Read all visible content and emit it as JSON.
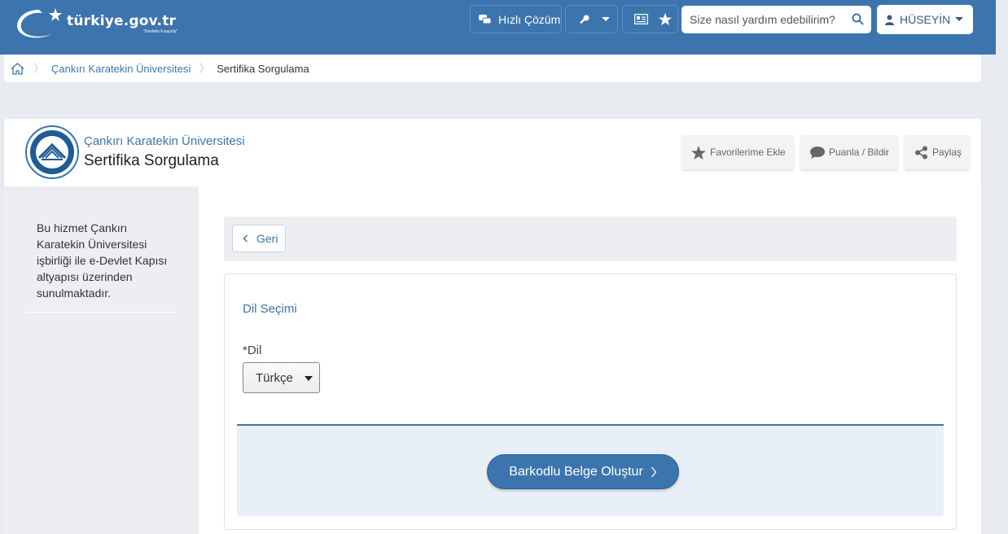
{
  "header": {
    "logo_text": "türkiye.gov.tr",
    "logo_tagline": "\"Devletin Kısayolu\"",
    "quick_solution_label": "Hızlı Çözüm",
    "search_placeholder": "Size nasıl yardım edebilirim?",
    "user_name": "HÜSEYİN"
  },
  "breadcrumb": {
    "items": [
      "Çankırı Karatekin Üniversitesi",
      "Sertifika Sorgulama"
    ]
  },
  "service": {
    "institution": "Çankırı Karatekin Üniversitesi",
    "title": "Sertifika Sorgulama",
    "actions": {
      "favorite": "Favorilerime Ekle",
      "rate": "Puanla / Bildir",
      "share": "Paylaş"
    }
  },
  "sidebar": {
    "info": "Bu hizmet Çankırı Karatekin Üniversitesi işbirliği ile e-Devlet Kapısı altyapısı üzerinden sunulmaktadır."
  },
  "main": {
    "back_label": "Geri",
    "legend": "Dil Seçimi",
    "field_label": "*Dil",
    "language_value": "Türkçe",
    "submit_label": "Barkodlu Belge Oluştur"
  },
  "colors": {
    "primary": "#3c75ad",
    "page_bg": "#e8ebef"
  }
}
